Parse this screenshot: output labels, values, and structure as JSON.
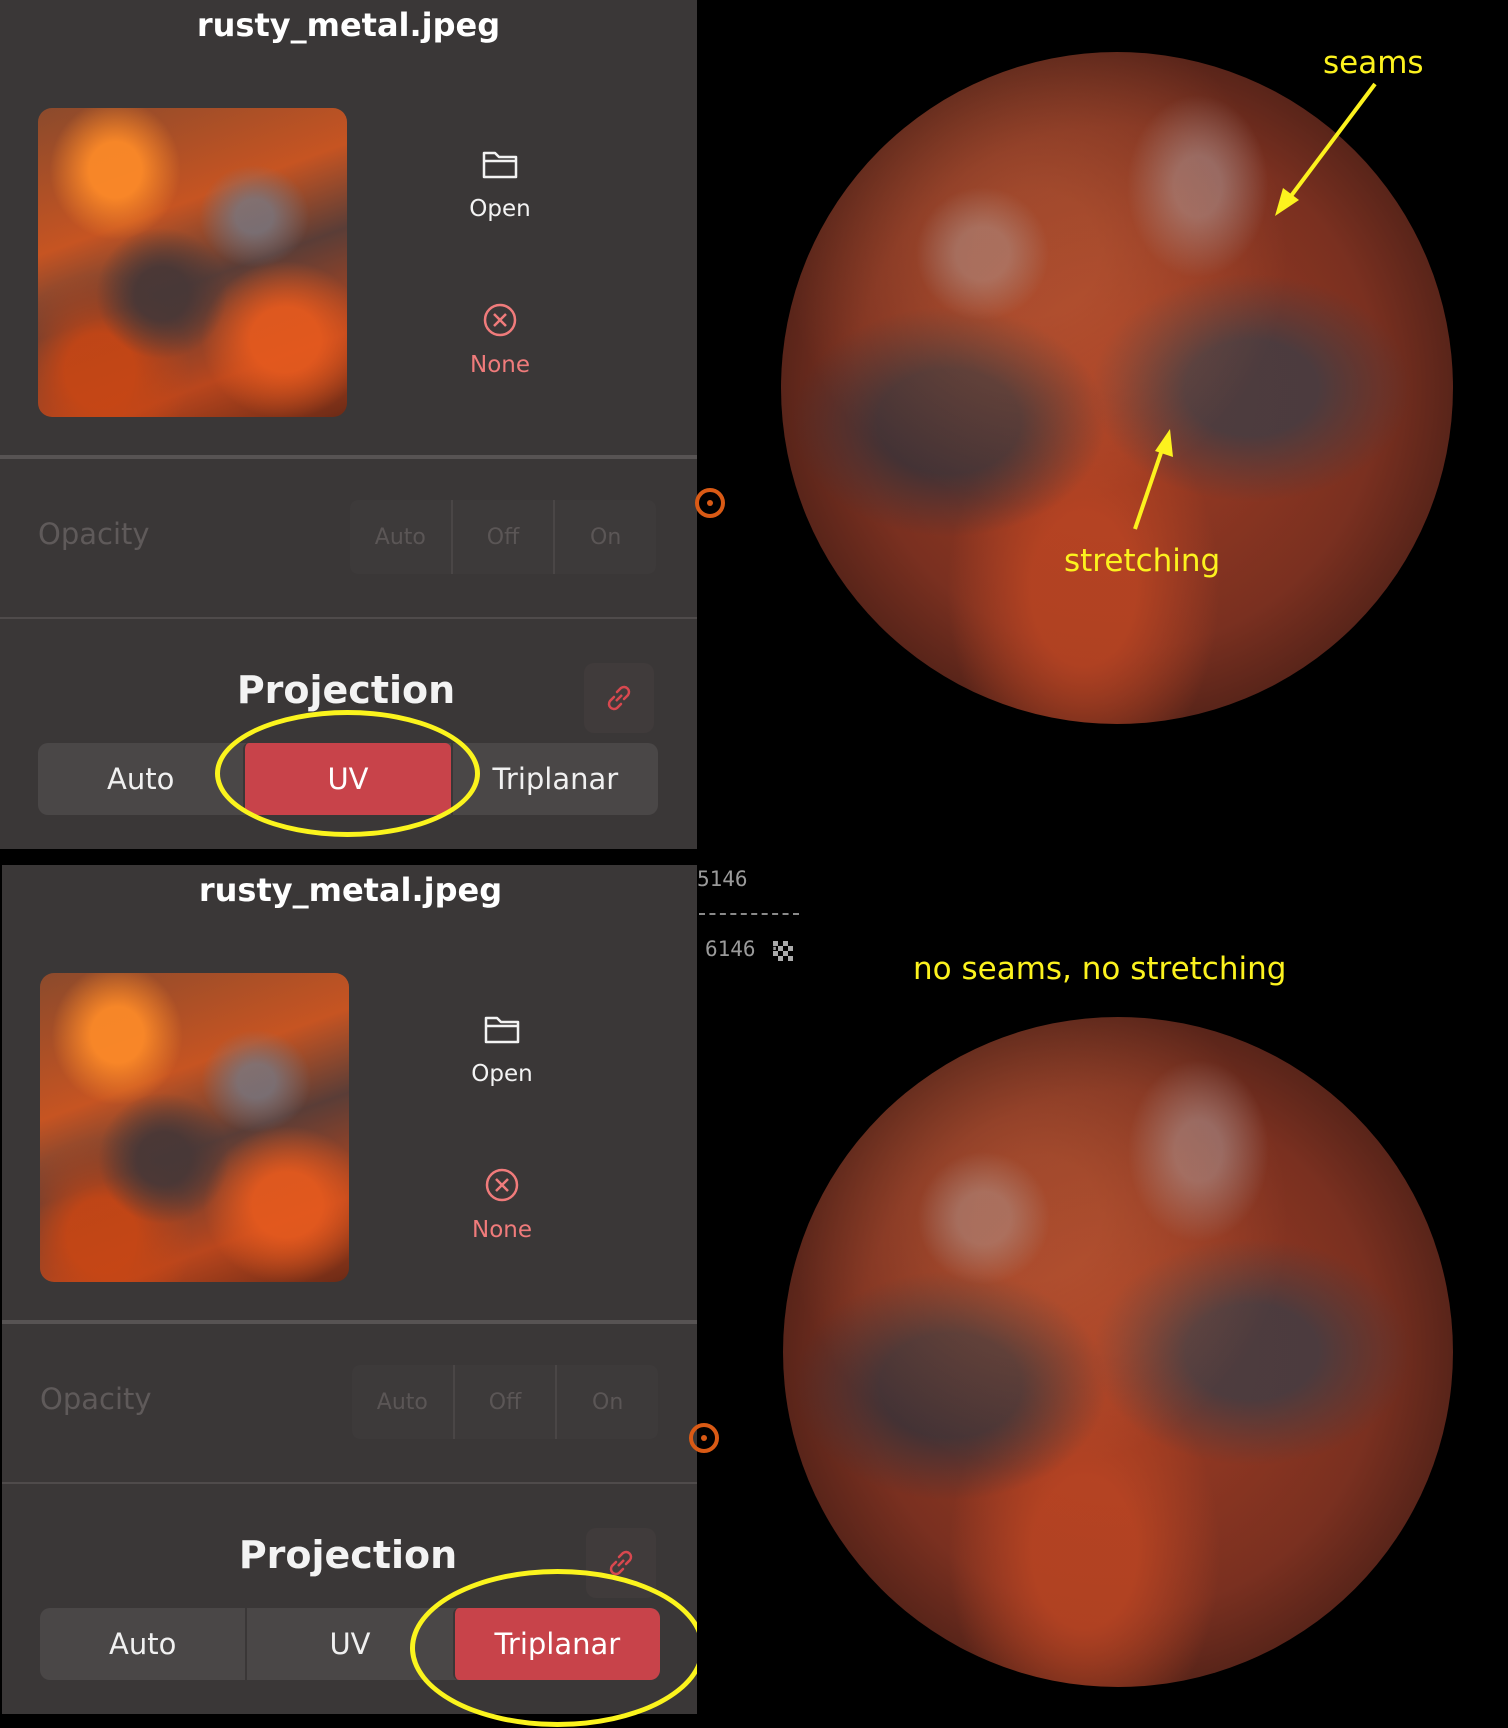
{
  "top": {
    "filename": "rusty_metal.jpeg",
    "open_label": "Open",
    "none_label": "None",
    "opacity_label": "Opacity",
    "opacity_options": [
      "Auto",
      "Off",
      "On"
    ],
    "projection_title": "Projection",
    "projection_options": [
      "Auto",
      "UV",
      "Triplanar"
    ],
    "projection_selected": "UV",
    "annotation_seams": "seams",
    "annotation_stretching": "stretching"
  },
  "bottom": {
    "filename": "rusty_metal.jpeg",
    "open_label": "Open",
    "none_label": "None",
    "opacity_label": "Opacity",
    "opacity_options": [
      "Auto",
      "Off",
      "On"
    ],
    "projection_title": "Projection",
    "projection_options": [
      "Auto",
      "UV",
      "Triplanar"
    ],
    "projection_selected": "Triplanar",
    "annotation": "no seams, no stretching",
    "hud_line1": "5146",
    "hud_line2": "6146 ·"
  },
  "colors": {
    "panel_bg": "#3a3737",
    "accent_red": "#c8434a",
    "none_red": "#f07b7b",
    "highlight_yellow": "#fbf41d",
    "origin_orange": "#d95a15"
  },
  "icons": {
    "open": "folder-icon",
    "none": "close-circle-icon",
    "link": "link-icon",
    "origin": "origin-marker-icon",
    "checker": "checkerboard-icon"
  }
}
